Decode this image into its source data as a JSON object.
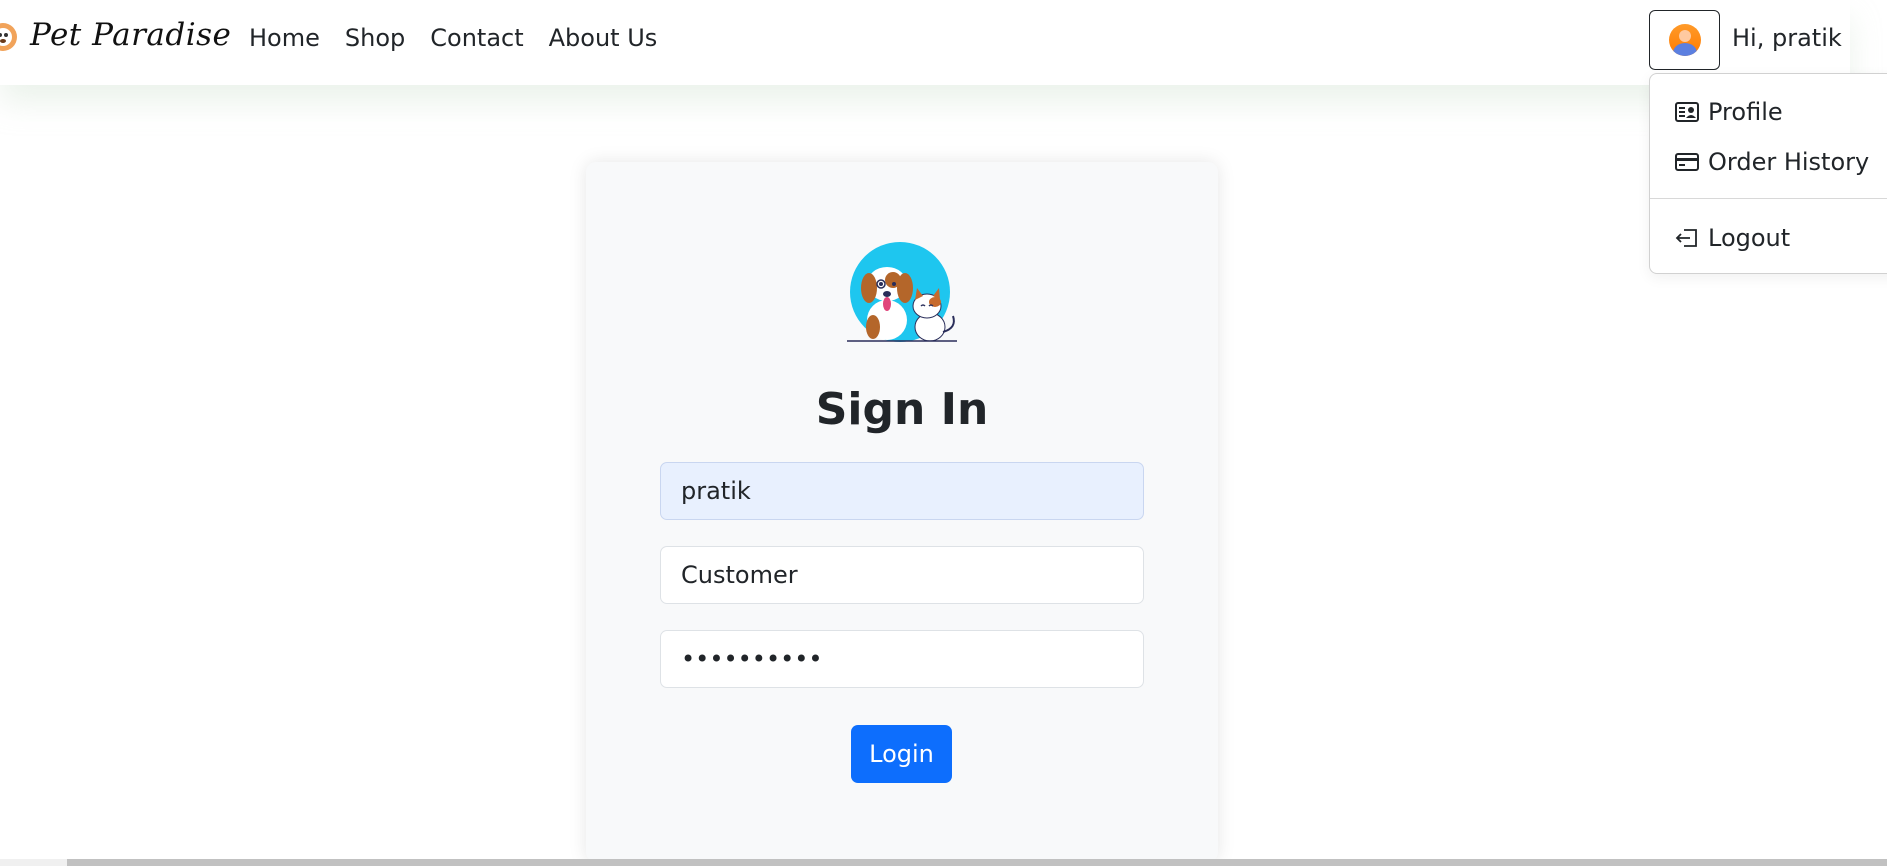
{
  "navbar": {
    "brand": "Pet Paradise",
    "links": [
      "Home",
      "Shop",
      "Contact",
      "About Us"
    ],
    "greeting": "Hi, pratik"
  },
  "user_menu": {
    "items": [
      {
        "label": "Profile",
        "icon": "profile-card-icon"
      },
      {
        "label": "Order History",
        "icon": "credit-card-icon"
      },
      {
        "label": "Logout",
        "icon": "logout-icon"
      }
    ]
  },
  "signin": {
    "title": "Sign In",
    "username_value": "pratik",
    "role_value": "Customer",
    "password_value": "pratik1234",
    "login_label": "Login"
  },
  "colors": {
    "primary": "#0d6efd",
    "autofill": "#e8f0fe",
    "avatar": "#ff8a1a",
    "logo_circle": "#1ec6ef"
  }
}
